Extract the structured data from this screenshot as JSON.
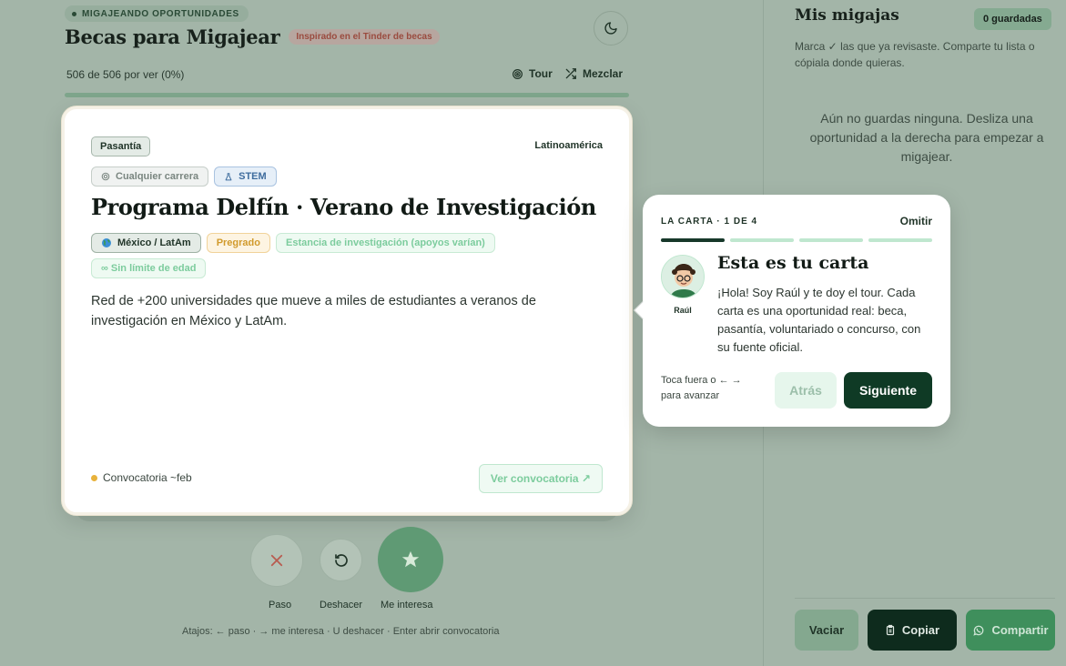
{
  "header": {
    "eyebrow": "MIGAJEANDO OPORTUNIDADES",
    "title": "Becas para Migajear",
    "inspired": "Inspirado en el Tinder de becas",
    "theme_icon": "moon-icon"
  },
  "progress": {
    "count_text": "506 de 506 por ver (0%)",
    "value": 0
  },
  "toolbar": {
    "tour_label": "Tour",
    "mix_label": "Mezclar"
  },
  "card": {
    "type": "Pasantía",
    "region": "Latinoamérica",
    "chips": [
      "Cualquier carrera",
      "STEM"
    ],
    "title": "Programa Delfín · Verano de Investigación",
    "tags": {
      "location": "México / LatAm",
      "level": "Pregrado",
      "funding": "Estancia de investigación (apoyos varían)",
      "age": "∞ Sin límite de edad"
    },
    "description": "Red de +200 universidades que mueve a miles de estudiantes a veranos de investigación en México y LatAm.",
    "deadline": "Convocatoria ~feb",
    "link_label": "Ver convocatoria ↗"
  },
  "actions": {
    "pass_label": "Paso",
    "undo_label": "Deshacer",
    "like_label": "Me interesa",
    "shortcuts": "Atajos: ← paso · → me interesa · U deshacer · Enter abrir convocatoria"
  },
  "panel": {
    "title": "Mis migajas",
    "saved_count": "0 guardadas",
    "note": "Marca ✓ las que ya revisaste. Comparte tu lista o cópiala donde quieras.",
    "empty_text": "Aún no guardas ninguna. Desliza una oportunidad a la derecha para empezar a migajear.",
    "buttons": {
      "clear": "Vaciar",
      "copy": "Copiar",
      "share": "Compartir"
    }
  },
  "tour": {
    "step": "LA CARTA · 1 DE 4",
    "skip": "Omitir",
    "steps_total": 4,
    "current_step": 1,
    "avatar_name": "Raúl",
    "title": "Esta es tu carta",
    "text": "¡Hola! Soy Raúl y te doy el tour. Cada carta es una oportunidad real: beca, pasantía, voluntariado o concurso, con su fuente oficial.",
    "hint": "Toca fuera o ← → para avanzar",
    "back_label": "Atrás",
    "next_label": "Siguiente"
  },
  "colors": {
    "accent_dark": "#0f3a25",
    "accent_green": "#7ccc9d",
    "deadline_dot": "#e8b23b",
    "overlay_bg": "#a3b5a8"
  }
}
